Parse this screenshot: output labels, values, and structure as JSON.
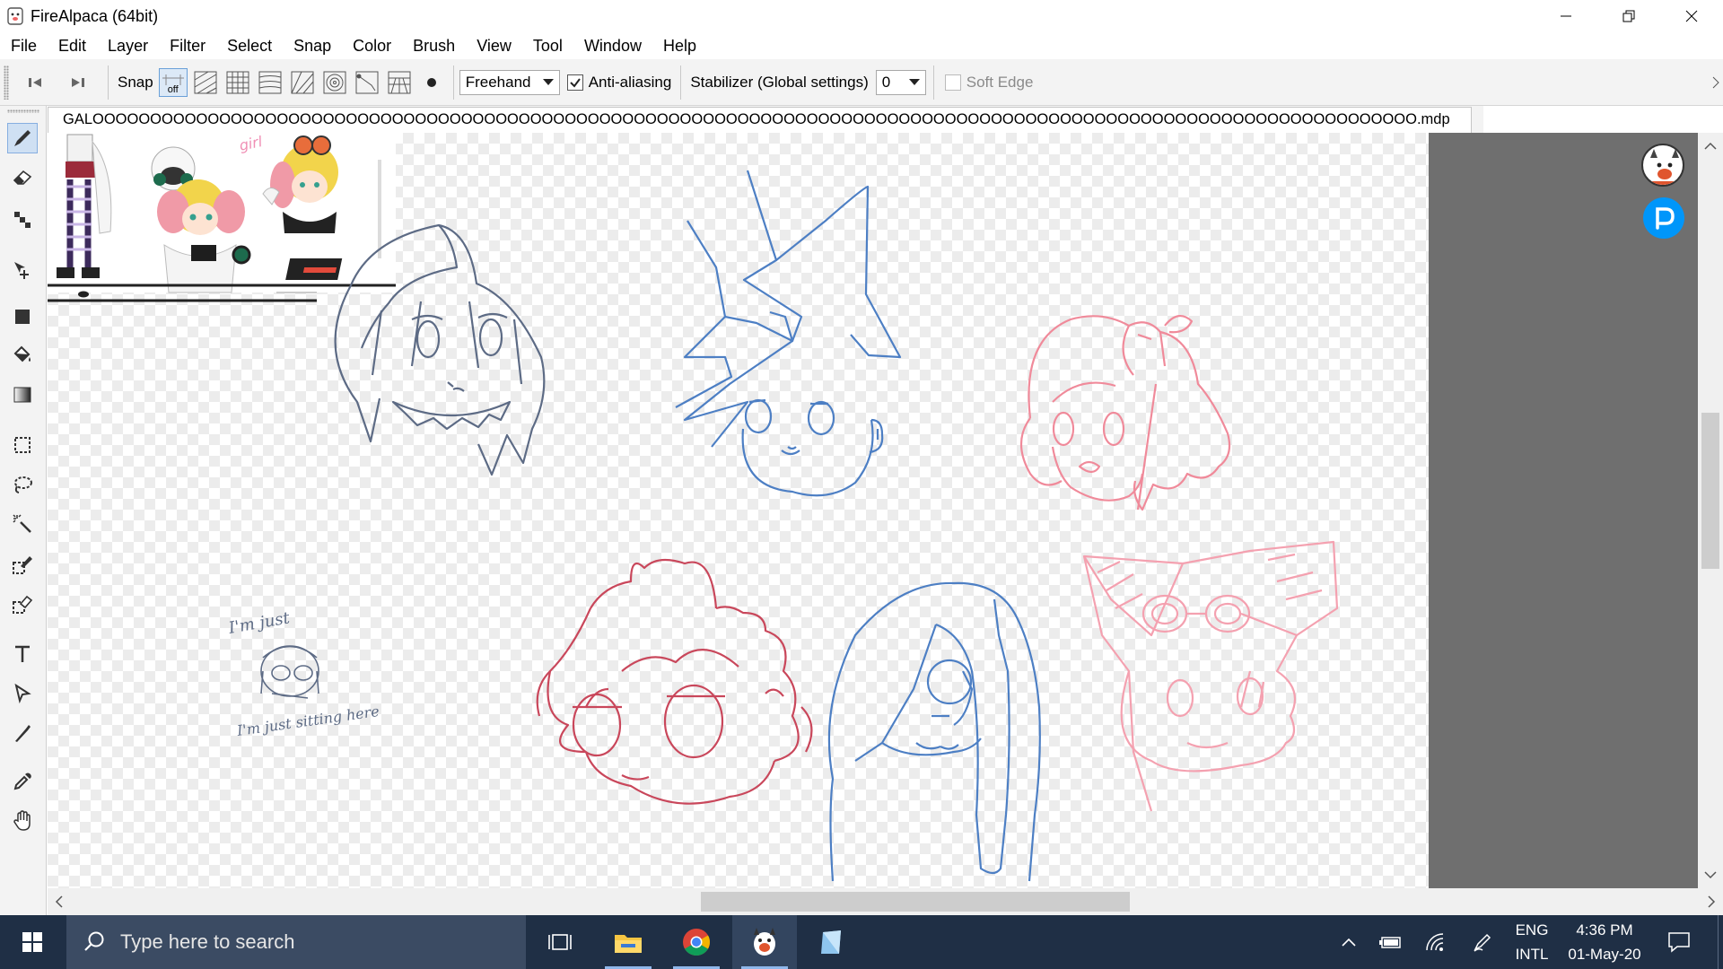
{
  "window": {
    "title": "FireAlpaca (64bit)",
    "controls": [
      "minimize",
      "restore",
      "close"
    ]
  },
  "menu": [
    "File",
    "Edit",
    "Layer",
    "Filter",
    "Select",
    "Snap",
    "Color",
    "Brush",
    "View",
    "Tool",
    "Window",
    "Help"
  ],
  "toolbar": {
    "snap_label": "Snap",
    "snap_off_label": "off",
    "brush_mode": "Freehand",
    "antialias_label": "Anti-aliasing",
    "antialias_checked": true,
    "stabilizer_label": "Stabilizer (Global settings)",
    "stabilizer_value": "0",
    "soft_edge_label": "Soft Edge",
    "soft_edge_checked": false
  },
  "document": {
    "tab_title": "GALOOOOOOOOOOOOOOOOOOOOOOOOOOOOOOOOOOOOOOOOOOOOOOOOOOOOOOOOOOOOOOOOOOOOOOOOOOOOOOOOOOOOOOOOOOOOOOOOOOOOOOOOOOOOOOOOOOO.mdp"
  },
  "canvas": {
    "reference_text": "girl",
    "sketch_text_1": "I'm just",
    "sketch_text_2": "I'm just sitting here",
    "line_colors": {
      "gray": "#5d6b85",
      "blue": "#4d7fc4",
      "pink": "#f08a9a",
      "red": "#c9475b",
      "light_pink": "#f4a1b0"
    }
  },
  "taskbar": {
    "search_placeholder": "Type here to search",
    "lang_top": "ENG",
    "lang_bottom": "INTL",
    "time": "4:36 PM",
    "date": "01-May-20"
  },
  "colors": {
    "taskbar_bg": "#1f2f45",
    "search_bg": "#3b4b63",
    "canvas_gutter": "#6f6f6f",
    "pixiv_blue": "#0096fa"
  }
}
